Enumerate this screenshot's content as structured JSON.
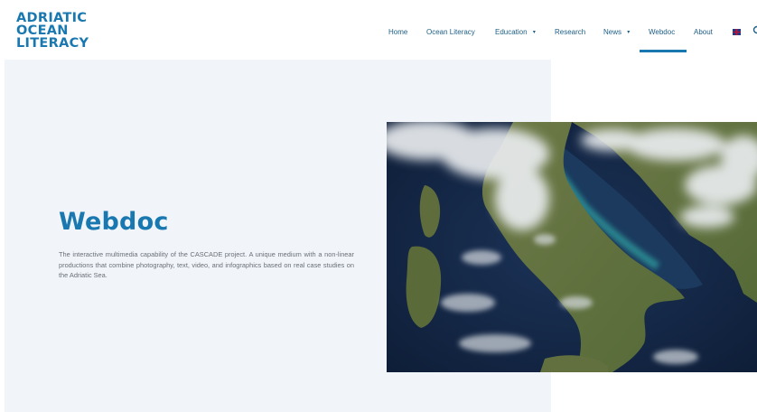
{
  "site": {
    "logo_lines": [
      "ADRIATIC",
      "OCEAN",
      "LITERACY"
    ]
  },
  "nav": {
    "items": [
      {
        "label": "Home",
        "has_dropdown": false,
        "active": false
      },
      {
        "label": "Ocean Literacy",
        "has_dropdown": false,
        "active": false
      },
      {
        "label": "Education",
        "has_dropdown": true,
        "active": false
      },
      {
        "label": "Research",
        "has_dropdown": false,
        "active": false
      },
      {
        "label": "News",
        "has_dropdown": true,
        "active": false
      },
      {
        "label": "Webdoc",
        "has_dropdown": false,
        "active": true
      },
      {
        "label": "About",
        "has_dropdown": false,
        "active": false
      }
    ],
    "language_flag": "uk-flag-icon",
    "caret_glyph": "▾",
    "accent_color": "#1a78b0"
  },
  "hero": {
    "title": "Webdoc",
    "description": "The interactive multimedia capability of the CASCADE project. A unique medium with a non-linear productions that combine photography, text, video, and infographics based on real case studies on the Adriatic Sea.",
    "image": "satellite-image-adriatic-sea"
  }
}
